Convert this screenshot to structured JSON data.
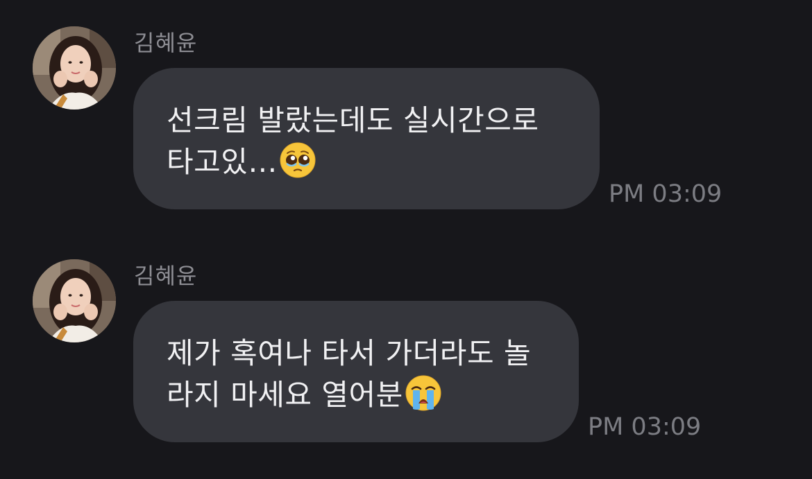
{
  "messages": [
    {
      "sender": "김혜윤",
      "lines": [
        "선크림 발랐는데도 실시간으로",
        "타고있…"
      ],
      "emoji": "pleading-face-icon",
      "time": "PM 03:09"
    },
    {
      "sender": "김혜윤",
      "lines": [
        "제가 혹여나 타서 가더라도 놀",
        "라지 마세요 열어분"
      ],
      "emoji": "loudly-crying-face-icon",
      "time": "PM 03:09"
    }
  ],
  "colors": {
    "background": "#17171b",
    "bubble": "#35363c",
    "message_text": "#f1f1f3",
    "sender_text": "#8e8e94",
    "time_text": "#7c7d83"
  }
}
